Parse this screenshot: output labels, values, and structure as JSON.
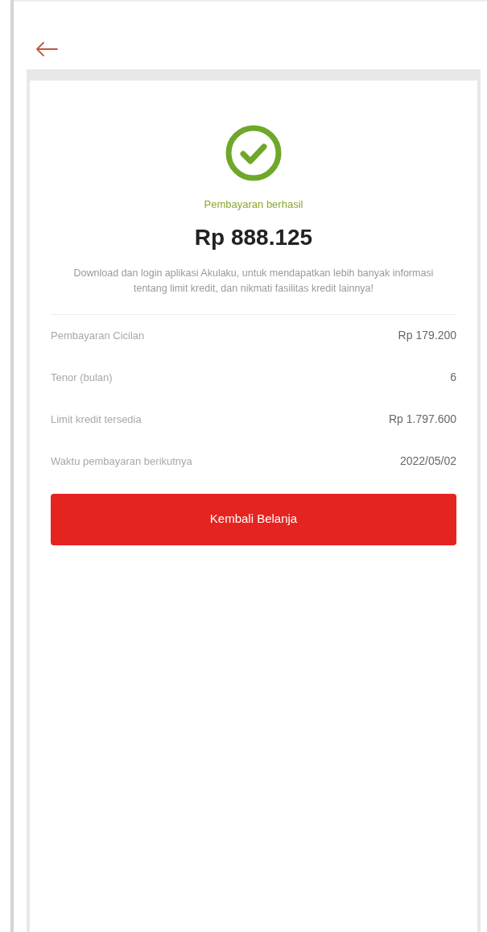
{
  "status": {
    "title": "Pembayaran berhasil",
    "amount": "Rp 888.125",
    "message": "Download dan login aplikasi Akulaku, untuk mendapatkan lebih banyak informasi tentang limit kredit, dan nikmati fasilitas kredit lainnya!"
  },
  "details": [
    {
      "label": "Pembayaran Cicilan",
      "value": "Rp 179.200"
    },
    {
      "label": "Tenor (bulan)",
      "value": "6"
    },
    {
      "label": "Limit kredit tersedia",
      "value": "Rp 1.797.600"
    },
    {
      "label": "Waktu pembayaran berikutnya",
      "value": "2022/05/02"
    }
  ],
  "button": "Kembali Belanja"
}
